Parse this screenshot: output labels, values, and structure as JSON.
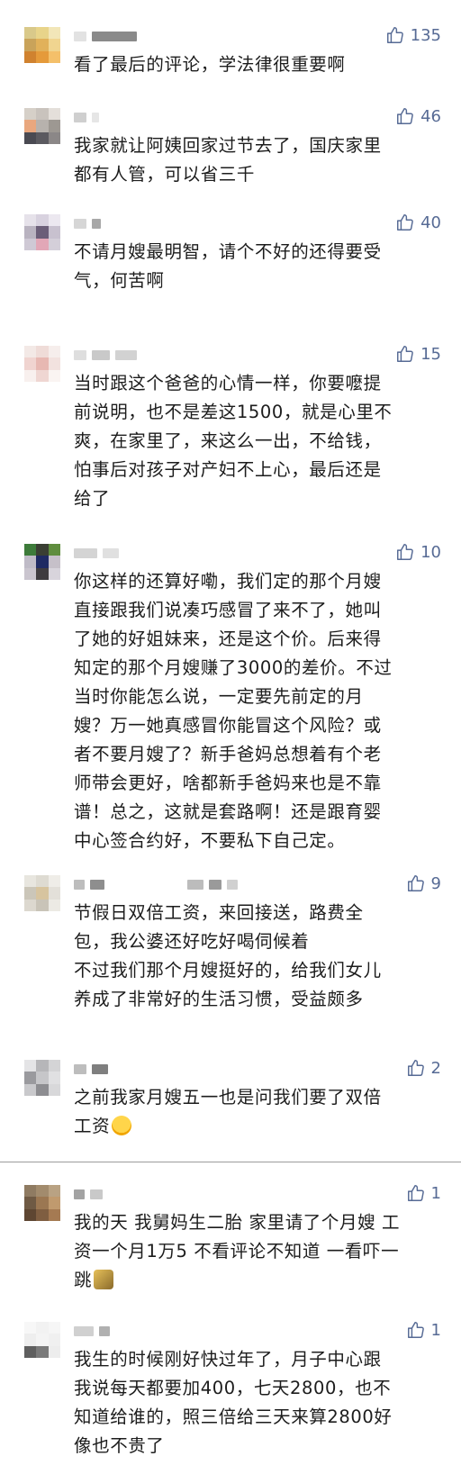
{
  "comments": [
    {
      "id": 1,
      "likes": "135",
      "text": "看了最后的评论，学法律很重要啊"
    },
    {
      "id": 2,
      "likes": "46",
      "text": "我家就让阿姨回家过节去了，国庆家里\n都有人管，可以省三千"
    },
    {
      "id": 3,
      "likes": "40",
      "text": "不请月嫂最明智，请个不好的还得要受\n气，何苦啊"
    },
    {
      "id": 4,
      "likes": "15",
      "text": "当时跟这个爸爸的心情一样，你要嚒提\n前说明，也不是差这1500，就是心里不\n爽，在家里了，来这么一出，不给钱，\n怕事后对孩子对产妇不上心，最后还是\n给了"
    },
    {
      "id": 5,
      "likes": "10",
      "text": "你这样的还算好嘞，我们定的那个月嫂\n直接跟我们说凑巧感冒了来不了，她叫\n了她的好姐妹来，还是这个价。后来得\n知定的那个月嫂赚了3000的差价。不过\n当时你能怎么说，一定要先前定的月\n嫂？万一她真感冒你能冒这个风险？或\n者不要月嫂了？新手爸妈总想着有个老\n师带会更好，啥都新手爸妈来也是不靠\n谱！总之，这就是套路啊！还是跟育婴\n中心签合约好，不要私下自己定。"
    },
    {
      "id": 6,
      "likes": "9",
      "text": "节假日双倍工资，来回接送，路费全\n包，我公婆还好吃好喝伺候着\n不过我们那个月嫂挺好的，给我们女儿\n养成了非常好的生活习惯，受益颇多"
    },
    {
      "id": 7,
      "likes": "2",
      "text": "之前我家月嫂五一也是问我们要了双倍\n工资",
      "emoji": "laughing-crying-emoji"
    },
    {
      "id": 8,
      "likes": "1",
      "text": "我的天 我舅妈生二胎 家里请了个月嫂 工\n资一个月1万5 不看评论不知道 一看吓一\n跳",
      "emoji": "surprised-emoji"
    },
    {
      "id": 9,
      "likes": "1",
      "text": "我生的时候刚好快过年了，月子中心跟\n我说每天都要加400，七天2800，也不\n知道给谁的，照三倍给三天来算2800好\n像也不贵了"
    }
  ],
  "colors": {
    "like_blue": "#576b95",
    "text": "#1c1c1c",
    "divider": "#9c9c9c"
  },
  "icons": {
    "like": "thumbs-up-outline-icon"
  }
}
